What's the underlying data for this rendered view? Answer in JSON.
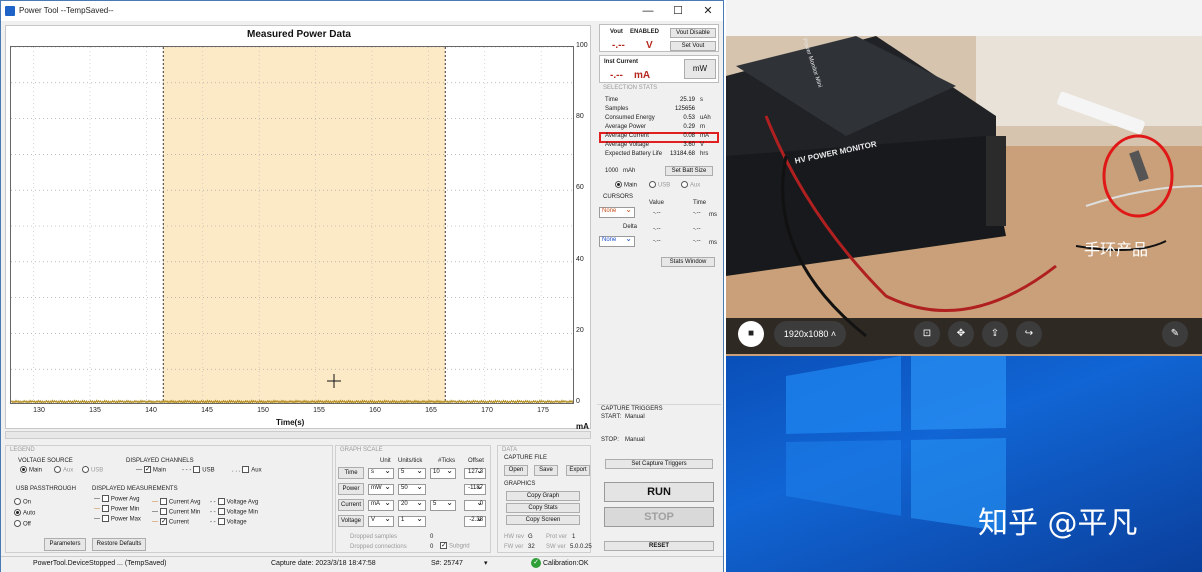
{
  "window": {
    "title": "Power Tool --TempSaved--",
    "min": "—",
    "max": "☐",
    "close": "✕"
  },
  "graph": {
    "title": "Measured Power Data",
    "xlabel": "Time(s)",
    "yunit": "mA",
    "yticks": [
      "100",
      "80",
      "60",
      "40",
      "20",
      "0"
    ],
    "xticks": [
      "130",
      "135",
      "140",
      "145",
      "150",
      "155",
      "160",
      "165",
      "170",
      "175"
    ]
  },
  "chart_data": {
    "type": "line",
    "title": "Measured Power Data",
    "xlabel": "Time(s)",
    "ylabel": "mA",
    "xlim": [
      128,
      178
    ],
    "ylim": [
      0,
      100
    ],
    "grid": true,
    "selection": [
      141.5,
      166.5
    ],
    "series": [
      {
        "name": "Current",
        "values": [
          0.08,
          0.08,
          0.08,
          0.08,
          0.08,
          0.08,
          0.08,
          0.08,
          0.08,
          0.08,
          0.08
        ]
      }
    ]
  },
  "vout": {
    "label": "Vout",
    "state": "ENABLED",
    "value": "-.--",
    "unit": "V",
    "disable_btn": "Vout Disable",
    "set_btn": "Set Vout"
  },
  "inst_current": {
    "label": "Inst Current",
    "value": "-.--",
    "unit": "mA",
    "mw_btn": "mW"
  },
  "stats": {
    "header": "SELECTION STATS",
    "rows": [
      {
        "label": "Time",
        "value": "25.19",
        "unit": "s"
      },
      {
        "label": "Samples",
        "value": "125656",
        "unit": ""
      },
      {
        "label": "Consumed Energy",
        "value": "0.53",
        "unit": "uAh"
      },
      {
        "label": "Average Power",
        "value": "0.29",
        "unit": "m"
      },
      {
        "label": "Average Current",
        "value": "0.08",
        "unit": "mA"
      },
      {
        "label": "Average Voltage",
        "value": "3.60",
        "unit": "V"
      },
      {
        "label": "Expected Battery Life",
        "value": "13184.68",
        "unit": "hrs"
      }
    ],
    "batt_value": "1000",
    "batt_unit": "mAh",
    "batt_btn": "Set Batt Size",
    "radio_main": "Main",
    "radio_usb": "USB",
    "radio_aux": "Aux"
  },
  "cursors": {
    "header": "CURSORS",
    "value_col": "Value",
    "time_col": "Time",
    "sel1": "None",
    "v1": "-.--",
    "t1": "-.--",
    "u1": "ms",
    "delta": "Delta",
    "sel2": "None",
    "v2": "-.--",
    "t2": "-.--",
    "u2": "ms",
    "stats_btn": "Stats Window"
  },
  "capture": {
    "header": "CAPTURE TRIGGERS",
    "start_label": "START:",
    "start_val": "Manual",
    "stop_label": "STOP:",
    "stop_val": "Manual",
    "set_btn": "Set Capture Triggers"
  },
  "run": {
    "run": "RUN",
    "stop": "STOP",
    "reset": "RESET"
  },
  "legend": {
    "header": "LEGEND",
    "vsrc": "VOLTAGE SOURCE",
    "vsrc_main": "Main",
    "vsrc_aux": "Aux",
    "vsrc_usb": "USB",
    "disp_ch": "DISPLAYED CHANNELS",
    "ch_main": "Main",
    "ch_usb": "USB",
    "ch_aux": "Aux",
    "usb_pt": "USB PASSTHROUGH",
    "pt_on": "On",
    "pt_auto": "Auto",
    "pt_off": "Off",
    "disp_meas": "DISPLAYED MEASUREMENTS",
    "m": [
      "Power Avg",
      "Power Min",
      "Power Max",
      "Current Avg",
      "Current Min",
      "Current",
      "Voltage Avg",
      "Voltage Min",
      "Voltage"
    ],
    "params_btn": "Parameters",
    "restore_btn": "Restore Defaults"
  },
  "graph_scale": {
    "header": "GRAPH SCALE",
    "col_unit": "Unit",
    "col_units_tick": "Units/tick",
    "col_ticks": "#Ticks",
    "col_offset": "Offset",
    "rows": [
      {
        "label": "Time",
        "unit": "s",
        "upt": "5",
        "ticks": "10",
        "offset": "127.3"
      },
      {
        "label": "Power",
        "unit": "mW",
        "upt": "50",
        "ticks": "",
        "offset": "-1187"
      },
      {
        "label": "Current",
        "unit": "mA",
        "upt": "20",
        "ticks": "5",
        "offset": "0"
      },
      {
        "label": "Voltage",
        "unit": "V",
        "upt": "1",
        "ticks": "",
        "offset": "-2.38"
      }
    ],
    "dropped_samples": "Dropped samples",
    "ds_val": "0",
    "dropped_conn": "Dropped connections",
    "dc_val": "0",
    "subgrid": "Subgrid"
  },
  "data": {
    "header": "DATA",
    "capture_file": "CAPTURE FILE",
    "open": "Open",
    "save": "Save",
    "export": "Export",
    "graphics": "GRAPHICS",
    "copy_graph": "Copy Graph",
    "copy_stats": "Copy Stats",
    "copy_screen": "Copy Screen",
    "hw_rev": "HW rev",
    "hw_val": "G",
    "prot_ver": "Prot ver",
    "prot_val": "1",
    "fw_ver": "FW ver",
    "fw_val": "32",
    "sw_ver": "SW ver",
    "sw_val": "5.0.0.25"
  },
  "status": {
    "left": "PowerTool.DeviceStopped ... (TempSaved)",
    "date": "Capture date: 2023/3/18 18:47:58",
    "serial": "S#: 25747",
    "calib": "Calibration:OK"
  },
  "camera": {
    "device_label": "HV POWER MONITOR",
    "device_side": "Power Monitor Mini",
    "annotation": "手环产品",
    "resolution": "1920x1080"
  },
  "watermark": "知乎 @平凡"
}
